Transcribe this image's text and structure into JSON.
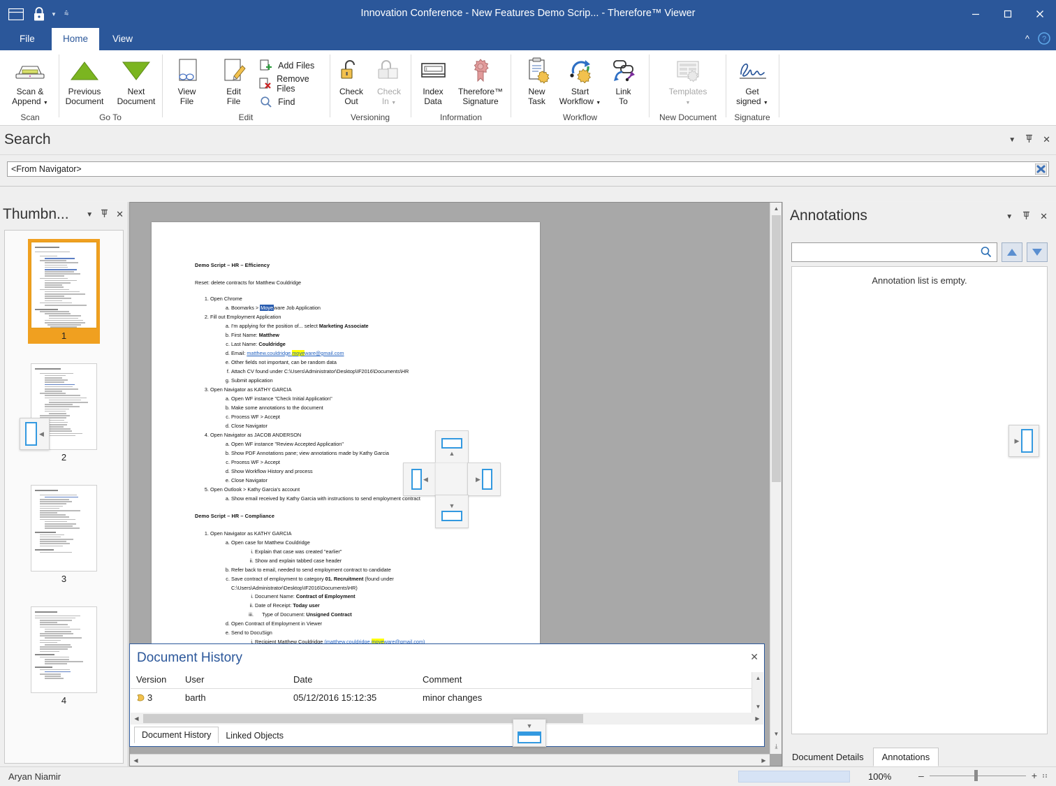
{
  "window": {
    "title": "Innovation Conference - New Features Demo Scrip... - Therefore™ Viewer",
    "minimize_label": "–",
    "maximize_label": "□",
    "close_label": "✕",
    "qat": [
      {
        "name": "save-icon",
        "label": "Save"
      },
      {
        "name": "lock-icon",
        "label": "Lock"
      },
      {
        "name": "customize-qat-icon",
        "label": "Customize Quick Access Toolbar"
      }
    ]
  },
  "ribbon": {
    "tabs": [
      {
        "label": "File",
        "active": false
      },
      {
        "label": "Home",
        "active": true
      },
      {
        "label": "View",
        "active": false
      }
    ],
    "collapse_label": "^",
    "help_label": "?",
    "groups": [
      {
        "label": "Scan",
        "buttons": [
          {
            "label_line1": "Scan &",
            "label_line2": "Append",
            "icon": "scanner-icon",
            "dropdown": true,
            "disabled": false
          }
        ]
      },
      {
        "label": "Go To",
        "buttons": [
          {
            "label_line1": "Previous",
            "label_line2": "Document",
            "icon": "triangle-up-icon",
            "dropdown": false,
            "disabled": false
          },
          {
            "label_line1": "Next",
            "label_line2": "Document",
            "icon": "triangle-down-icon",
            "dropdown": false,
            "disabled": false
          }
        ]
      },
      {
        "label": "Edit",
        "buttons": [
          {
            "label_line1": "View",
            "label_line2": "File",
            "icon": "view-file-icon",
            "dropdown": false,
            "disabled": false
          },
          {
            "label_line1": "Edit",
            "label_line2": "File",
            "icon": "edit-file-icon",
            "dropdown": false,
            "disabled": false
          }
        ],
        "small_buttons": [
          {
            "label": "Add Files",
            "icon": "add-files-icon"
          },
          {
            "label": "Remove Files",
            "icon": "remove-files-icon"
          },
          {
            "label": "Find",
            "icon": "find-icon"
          }
        ]
      },
      {
        "label": "Versioning",
        "buttons": [
          {
            "label_line1": "Check",
            "label_line2": "Out",
            "icon": "unlock-icon",
            "dropdown": false,
            "disabled": false
          },
          {
            "label_line1": "Check",
            "label_line2": "In",
            "icon": "lock-document-icon",
            "dropdown": true,
            "disabled": true
          }
        ]
      },
      {
        "label": "Information",
        "buttons": [
          {
            "label_line1": "Index",
            "label_line2": "Data",
            "icon": "index-data-icon",
            "dropdown": false,
            "disabled": false
          },
          {
            "label_line1": "Therefore™",
            "label_line2": "Signature",
            "icon": "signature-seal-icon",
            "dropdown": false,
            "disabled": false
          }
        ]
      },
      {
        "label": "Workflow",
        "buttons": [
          {
            "label_line1": "New",
            "label_line2": "Task",
            "icon": "new-task-icon",
            "dropdown": false,
            "disabled": false
          },
          {
            "label_line1": "Start",
            "label_line2": "Workflow",
            "icon": "start-workflow-icon",
            "dropdown": true,
            "disabled": false
          },
          {
            "label_line1": "Link",
            "label_line2": "To",
            "icon": "link-to-icon",
            "dropdown": false,
            "disabled": false
          }
        ]
      },
      {
        "label": "New Document",
        "buttons": [
          {
            "label_line1": "Templates",
            "label_line2": "",
            "icon": "templates-icon",
            "dropdown": true,
            "disabled": true
          }
        ]
      },
      {
        "label": "Signature",
        "buttons": [
          {
            "label_line1": "Get",
            "label_line2": "signed",
            "icon": "handwritten-signature-icon",
            "dropdown": true,
            "disabled": false
          }
        ]
      }
    ]
  },
  "search_panel": {
    "title": "Search",
    "input_value": "<From Navigator>",
    "input_placeholder": "<From Navigator>",
    "clear_label": "✖",
    "tools": [
      {
        "name": "dropdown-icon",
        "label": "▼"
      },
      {
        "name": "pin-icon",
        "label": "⚲"
      },
      {
        "name": "close-icon",
        "label": "✕"
      }
    ]
  },
  "thumbnails": {
    "title": "Thumbn...",
    "tools": [
      {
        "name": "dropdown-icon",
        "label": "▼"
      },
      {
        "name": "pin-icon",
        "label": "⚲"
      },
      {
        "name": "close-icon",
        "label": "✕"
      }
    ],
    "pages": [
      {
        "number": "1",
        "selected": true
      },
      {
        "number": "2",
        "selected": false
      },
      {
        "number": "3",
        "selected": false
      },
      {
        "number": "4",
        "selected": false
      }
    ]
  },
  "document": {
    "heading1": "Demo Script – HR – Efficiency",
    "reset_line": "Reset: delete contracts for Matthew Couldridge",
    "section1": [
      {
        "text": "Open Chrome",
        "children": [
          {
            "text": "Boomarks > Moveware Job Application",
            "highlight_blue": "Moye"
          }
        ]
      },
      {
        "text": "Fill out Employment Application",
        "children": [
          {
            "text": "I'm applying for the position of... select Marketing Associate"
          },
          {
            "text": "First Name: Matthew"
          },
          {
            "text": "Last Name: Couldridge"
          },
          {
            "text": "Email: matthew.couldridge.moveware@gmail.com",
            "link": true,
            "highlight_yellow": "moye"
          },
          {
            "text": "Other fields not important, can be random data"
          },
          {
            "text": "Attach CV found under C:\\Users\\Administrator\\Desktop\\IF2016\\Documents\\HR"
          },
          {
            "text": "Submit application"
          }
        ]
      },
      {
        "text": "Open Navigator as KATHY GARCIA",
        "children": [
          {
            "text": "Open WF instance \"Check Initial Application\""
          },
          {
            "text": "Make some annotations to the document"
          },
          {
            "text": "Process WF > Accept"
          },
          {
            "text": "Close Navigator"
          }
        ]
      },
      {
        "text": "Open Navigator as JACOB ANDERSON",
        "children": [
          {
            "text": "Open WF instance \"Review Accepted Application\""
          },
          {
            "text": "Show PDF Annotations pane; view annotations made by Kathy Garcia"
          },
          {
            "text": "Process WF > Accept"
          },
          {
            "text": "Show Workflow History and process"
          },
          {
            "text": "Close Navigator"
          }
        ]
      },
      {
        "text": "Open Outlook > Kathy Garcia's account",
        "children": [
          {
            "text": "Show email received by Kathy Garcia with instructions to send employment contract"
          }
        ]
      }
    ],
    "heading2": "Demo Script – HR – Compliance",
    "section2": [
      {
        "text": "Open Navigator as KATHY GARCIA",
        "children": [
          {
            "text": "Open case for Matthew Couldridge",
            "subchildren": [
              {
                "text": "Explain that case was created \"earlier\""
              },
              {
                "text": "Show and explain tabbed case header"
              }
            ]
          },
          {
            "text": "Refer back to email, needed to send employment contract to candidate"
          },
          {
            "text": "Save contract of employment to category 01. Recruitment (found under C:\\Users\\Administrator\\Desktop\\IF2016\\Documents\\HR)",
            "subchildren": [
              {
                "text": "Document Name: Contract of Employment"
              },
              {
                "text": "Date of Receipt: Today user"
              },
              {
                "text": "Type of Document: Unsigned Contract"
              }
            ]
          },
          {
            "text": "Open Contract of Employment in Viewer"
          },
          {
            "text": "Send to DocuSign",
            "subchildren": [
              {
                "text": "Recipient Matthew Couldridge (matthew.couldridge.moveware@gmail.com)"
              }
            ]
          }
        ]
      }
    ]
  },
  "annotations": {
    "title": "Annotations",
    "search_value": "",
    "search_placeholder": "",
    "search_icon_label": "⌕",
    "prev_label": "▲",
    "next_label": "▼",
    "empty_message": "Annotation list is empty.",
    "tools": [
      {
        "name": "dropdown-icon",
        "label": "▼"
      },
      {
        "name": "pin-icon",
        "label": "⚲"
      },
      {
        "name": "close-icon",
        "label": "✕"
      }
    ],
    "tabs": [
      {
        "label": "Document Details",
        "active": false
      },
      {
        "label": "Annotations",
        "active": true
      }
    ]
  },
  "document_history": {
    "title": "Document History",
    "close_label": "✕",
    "columns": [
      "Version",
      "User",
      "Date",
      "Comment"
    ],
    "rows": [
      {
        "version": "3",
        "user": "barth",
        "date": "05/12/2016 15:12:35",
        "comment": "minor changes"
      }
    ],
    "tabs": [
      {
        "label": "Document History",
        "active": true
      },
      {
        "label": "Linked Objects",
        "active": false
      }
    ]
  },
  "statusbar": {
    "user": "Aryan Niamir",
    "zoom": "100%",
    "zoom_out_label": "–",
    "zoom_in_label": "+"
  },
  "colors": {
    "titlebar": "#2b579a",
    "accent_blue": "#2b579a",
    "dock_blue": "#3399e0",
    "selection_orange": "#f0a020",
    "highlight_yellow": "#ffff00",
    "highlight_blue": "#2a5db0",
    "green": "#7bb520"
  }
}
